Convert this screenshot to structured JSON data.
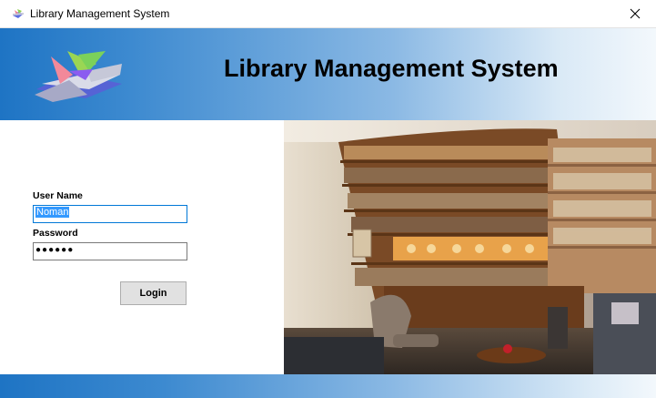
{
  "window": {
    "title": "Library Management System",
    "app_icon": "app-logo-icon",
    "close_icon": "close-icon"
  },
  "header": {
    "title": "Library Management System",
    "logo_icon": "geometric-logo-icon"
  },
  "login_form": {
    "username_label": "User Name",
    "username_value": "Noman",
    "password_label": "Password",
    "password_value": "●●●●●●",
    "login_button": "Login"
  },
  "hero_image": {
    "description_icon": "library-interior-photo"
  },
  "colors": {
    "header_gradient_start": "#1e74c4",
    "header_gradient_end": "#f3f8fc",
    "focus_border": "#0078d7",
    "selection": "#3399ff"
  }
}
